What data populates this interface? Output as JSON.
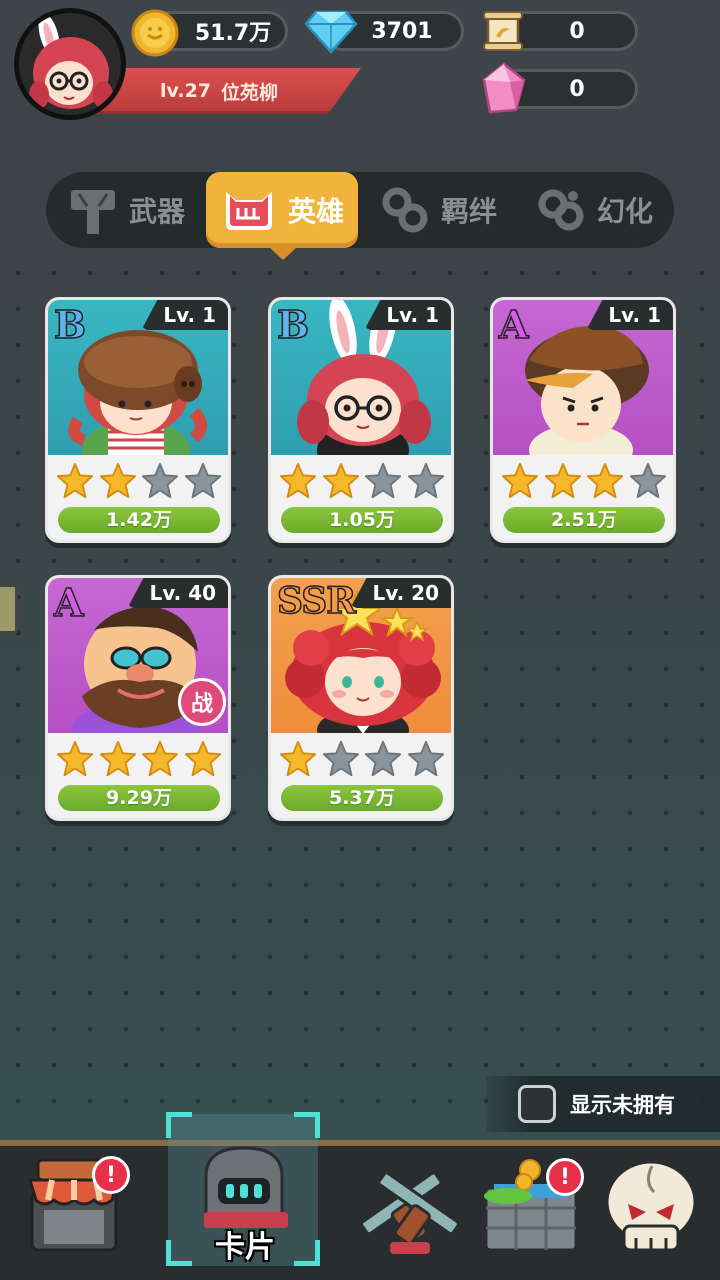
{
  "player": {
    "level": "lv.27",
    "name": "位苑柳"
  },
  "currencies": {
    "gold": "51.7万",
    "diamond": "3701",
    "scroll": "0",
    "crystal": "0"
  },
  "tabs": [
    {
      "label": "武器",
      "icon": "hammer-icon",
      "active": false
    },
    {
      "label": "英雄",
      "icon": "cat-hero-icon",
      "active": true
    },
    {
      "label": "羁绊",
      "icon": "chain-icon",
      "active": false
    },
    {
      "label": "幻化",
      "icon": "transform-icon",
      "active": false
    }
  ],
  "heroes": [
    {
      "rarity": "B",
      "level": "Lv. 1",
      "stars": 2,
      "max_stars": 4,
      "power": "1.42万",
      "portrait": "helmet-girl",
      "in_battle": false
    },
    {
      "rarity": "B",
      "level": "Lv. 1",
      "stars": 2,
      "max_stars": 4,
      "power": "1.05万",
      "portrait": "bunny-girl",
      "in_battle": false
    },
    {
      "rarity": "A",
      "level": "Lv. 1",
      "stars": 3,
      "max_stars": 4,
      "power": "2.51万",
      "portrait": "explorer-boy",
      "in_battle": false
    },
    {
      "rarity": "A",
      "level": "Lv. 40",
      "stars": 4,
      "max_stars": 4,
      "power": "9.29万",
      "portrait": "bearded-man",
      "in_battle": true,
      "battle_label": "战"
    },
    {
      "rarity": "SSR",
      "level": "Lv. 20",
      "stars": 1,
      "max_stars": 4,
      "power": "5.37万",
      "portrait": "curly-hair-girl",
      "in_battle": false
    }
  ],
  "show_unowned": {
    "label": "显示未拥有",
    "checked": false
  },
  "bottom_nav": {
    "items": [
      {
        "icon": "shop-icon",
        "badge": "!"
      },
      {
        "icon": "knight-helmet-icon",
        "label": "卡片",
        "selected": true
      },
      {
        "icon": "crossed-guns-icon"
      },
      {
        "icon": "treasure-chest-icon",
        "badge": "!"
      },
      {
        "icon": "skull-icon"
      }
    ]
  },
  "colors": {
    "accent": "#f0b43c",
    "power_bar": "#7ab934",
    "rarity_b": "#39b7c3",
    "rarity_a": "#c668d4",
    "rarity_ssr": "#f3a04d"
  }
}
